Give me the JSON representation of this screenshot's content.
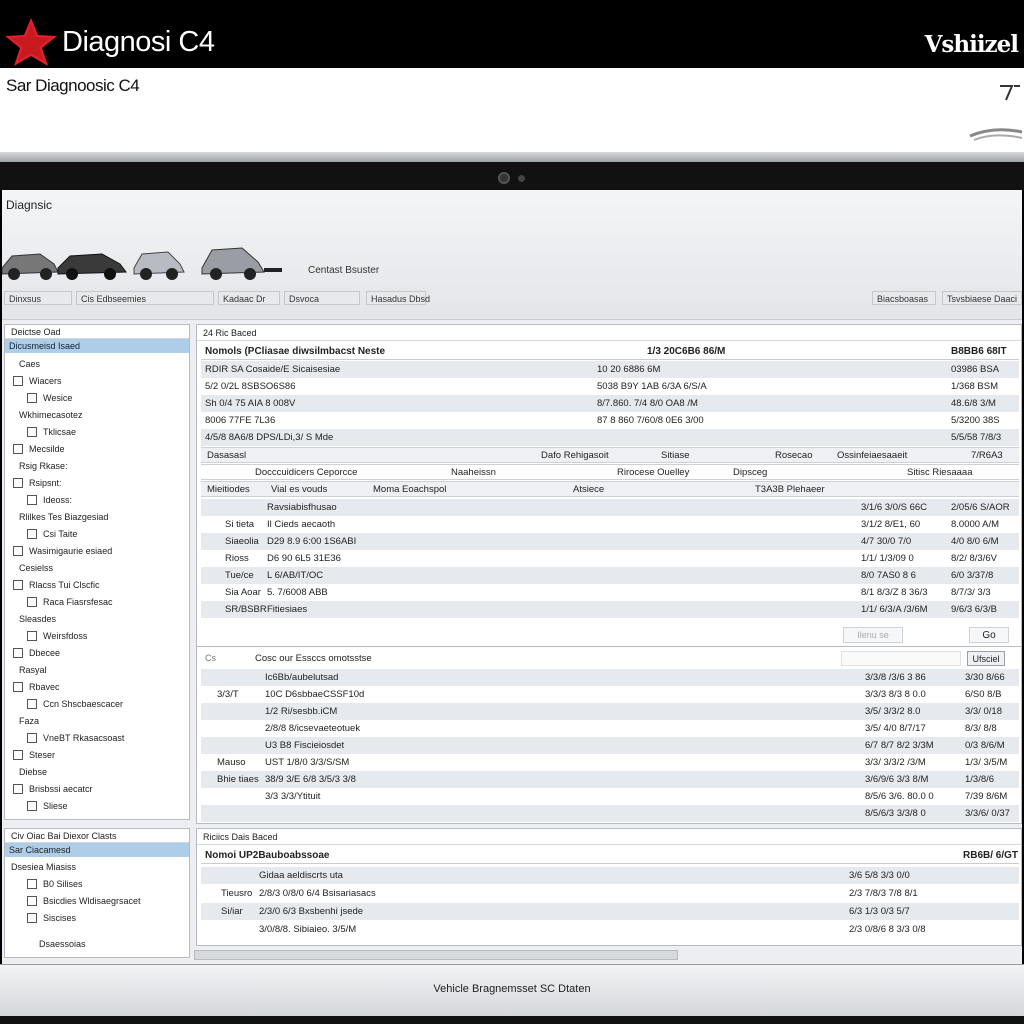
{
  "topbar": {
    "app_name": "Diagnosi C4",
    "brand": "Vshiizel"
  },
  "whitebar": {
    "subtitle": "Sar Diagnoosic C4"
  },
  "header": {
    "title": "Diagnsic",
    "center_label": "Centast Bsuster",
    "toolbar": [
      "Dinxsus",
      "Cis Edbseemies",
      "Kadaac Dr",
      "Dsvoca",
      "Hasadus Dbsd",
      "Biacsboasas",
      "Tsvsbiaese Daaci"
    ]
  },
  "left_panel": {
    "title": "Deictse Oad",
    "selected": "Dicusmeisd Isaed",
    "items": [
      "Caes",
      "Wiacers",
      "Wesice",
      "Wkhimecasotez",
      "Tklicsae",
      "Mecsilde",
      "Rsig Rkase:",
      "Rsipsnt:",
      "Ideoss:",
      "Rlilkes Tes Biazgesiad",
      "Csi Taite",
      "Wasimigaurie esiaed",
      "Cesielss",
      "Rlacss Tui Clscfic",
      "Raca Fiasrsfesac",
      "Sleasdes",
      "Weirsfdoss",
      "Dbecee",
      "Rasyal",
      "Rbavec",
      "Ccn Shscbaescacer",
      "Faza",
      "VneBT Rkasacsoast",
      "Steser",
      "Diebse",
      "Brisbssi aecatcr",
      "Sliese"
    ]
  },
  "left_panel2": {
    "title": "Civ Oiac Bai Diexor Clasts",
    "selected": "Sar Ciacamesd",
    "items": [
      "Dsesiea Miasiss",
      "B0 Silises",
      "Bsicdies Wldisaegrsacet",
      "Siscises"
    ],
    "footer": "Dsaessoias"
  },
  "main_panel": {
    "title": "24 Ric Baced",
    "head": {
      "c1": "Nomols (PCliasae diwsilmbacst Neste",
      "c2": "1/3 20C6B6 86/M",
      "c3": "B8BB6 68IT"
    },
    "top_rows": [
      [
        "RDIR SA Cosaide/E Sicaisesiae",
        "10 20 6886 6M",
        "03986 BSA"
      ],
      [
        "5/2 0/2L 8SBSO6S86",
        "5038 B9Y 1AB 6/3A 6/S/A",
        "1/368 BSM"
      ],
      [
        "Sh 0/4 75 AIA 8 008V",
        "8/7.860. 7/4 8/0 OA8 /M",
        "48.6/8 3/M"
      ],
      [
        "8006 77FE 7L36",
        "87 8 860 7/60/8 0E6 3/00",
        "5/3200 38S"
      ],
      [
        "4/5/8 8A6/8 DPS/LDi,3/ S Mde",
        "",
        "5/5/58 7/8/3"
      ]
    ],
    "columns1": [
      "Dasasasl",
      "Dafo Rehigasoit",
      "Sitiase",
      "Rosecao",
      "Ossinfeiaesaaeit",
      "7/R6A3"
    ],
    "columns2": [
      "Docccuidicers Ceporcce",
      "Naaheissn",
      "Rirocese Ouelley",
      "Dipsceg",
      "Sitisc Riesaaaa"
    ],
    "columns3": [
      "Mieitiodes",
      "Vial es vouds",
      "Moma Eoachspol",
      "Atsiece",
      "T3A3B Plehaeer"
    ],
    "mid_rows": [
      [
        "",
        "Ravsiabisfhusao",
        "3/1/6 3/0/S 66C",
        "2/05/6 S/AOR"
      ],
      [
        "Si tieta",
        "Il Cieds aecaoth",
        "3/1/2 8/E1, 60",
        "8.0000 A/M"
      ],
      [
        "Siaeolia",
        "D29 8.9 6:00 1S6ABI",
        "4/7 30/0 7/0",
        "4/0 8/0 6/M"
      ],
      [
        "Rioss",
        "D6 90 6L5 31E36",
        "1/1/ 1/3/09 0",
        "8/2/ 8/3/6V"
      ],
      [
        "Tue/ce",
        "L 6/AB/IT/OC",
        "8/0 7AS0 8 6",
        "6/0 3/37/8"
      ],
      [
        "Sia Aoar",
        "5. 7/6008 ABB",
        "8/1 8/3/Z 8 36/3",
        "8/7/3/ 3/3"
      ],
      [
        "SR/BSBR",
        "Fitiesiaes",
        "1/1/ 6/3/A /3/6M",
        "9/6/3 6/3/B"
      ]
    ],
    "go_label": "Go",
    "faint_label": "Ilenu se"
  },
  "sub_panel": {
    "title": "Cosc our Essccs omotsstse",
    "side": "Cs",
    "button": "Ufsciel",
    "rows": [
      [
        "",
        "Ic6Bb/aubelutsad",
        "3/3/8 /3/6 3 86",
        "3/30 8/66"
      ],
      [
        "3/3/T",
        "10C D6sbbaeCSSF10d",
        "3/3/3 8/3 8 0.0",
        "6/S0 8/B"
      ],
      [
        "",
        "1/2 Ri/sesbb.iCM",
        "3/5/ 3/3/2 8.0",
        "3/3/ 0/18"
      ],
      [
        "",
        "2/8/8 8/icsevaeteotuek",
        "3/5/ 4/0 8/7/17",
        "8/3/ 8/8"
      ],
      [
        "",
        "U3 B8 Fiscieiosdet",
        "6/7 8/7 8/2 3/3M",
        "0/3 8/6/M"
      ],
      [
        "Mauso",
        "UST 1/8/0 3/3/S/SM",
        "3/3/ 3/3/2 /3/M",
        "1/3/ 3/5/M"
      ],
      [
        "Bhie tiaes",
        "38/9 3/E 6/8 3/5/3 3/8",
        "3/6/9/6 3/3 8/M",
        "1/3/8/6"
      ],
      [
        "",
        "3/3 3/3/Ytituit",
        "8/5/6 3/6. 80.0 0",
        "7/39 8/6M"
      ],
      [
        "",
        "",
        "8/5/6/3 3/3/8 0",
        "3/3/6/ 0/37"
      ]
    ]
  },
  "bottom_panel": {
    "title": "Riciics Dais Baced",
    "head": {
      "c1": "Nomoi UP2Bauboabssoae",
      "c2": "",
      "c3": "RB6B/ 6/GT"
    },
    "rows": [
      [
        "",
        "Gidaa aeldiscrts uta",
        "3/6 5/8 3/3 0/0",
        ""
      ],
      [
        "Tieusro",
        "2/8/3 0/8/0 6/4 Bsisariasacs",
        "2/3 7/8/3 7/8 8/1",
        ""
      ],
      [
        "Si/iar",
        "2/3/0 6/3 Bxsbenhi jsede",
        "6/3 1/3 0/3 5/7",
        ""
      ],
      [
        "",
        "3/0/8/8. Sibiaieo. 3/5/M",
        "2/3 0/8/6 8 3/3 0/8",
        ""
      ]
    ]
  },
  "status": {
    "text": "Vehicle Bragnemsset SC Dtaten"
  },
  "colors": {
    "accent": "#aecde9",
    "star_red": "#e0202a",
    "topbar": "#000000"
  }
}
